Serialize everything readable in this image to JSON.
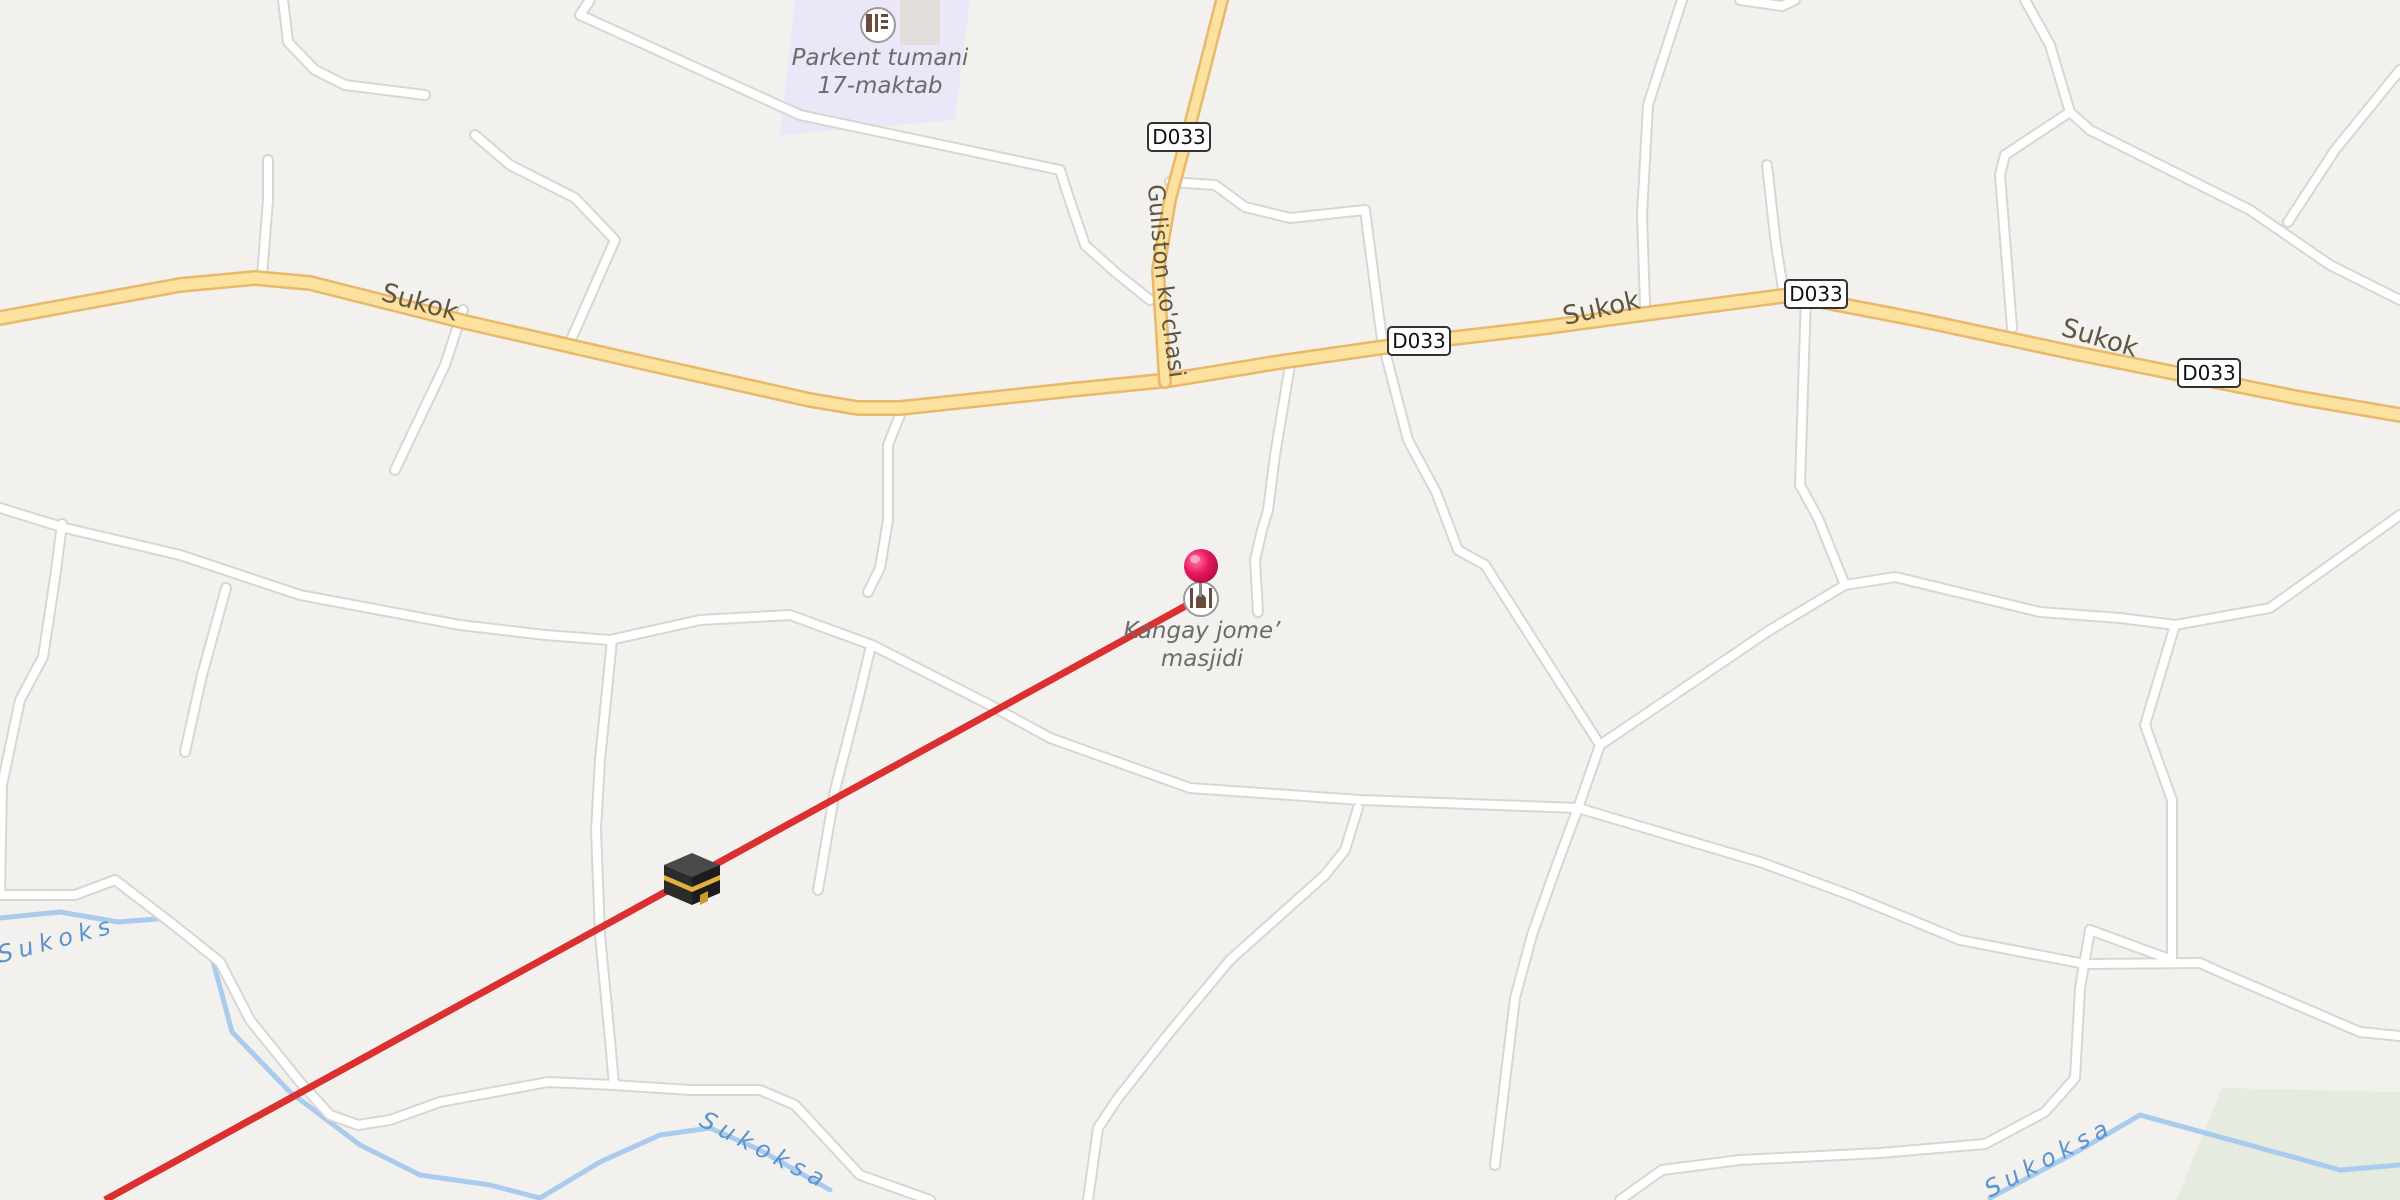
{
  "map": {
    "colors": {
      "background": "#f3f1ee",
      "minor_road": "#ffffff",
      "minor_road_casing": "#d9d6d1",
      "major_road": "#fce29e",
      "major_road_casing": "#e8b86b",
      "river": "#a9cbee",
      "river_label": "#5b93cf",
      "school_area": "#ebe6f8",
      "greenery": "#e6ebe0",
      "qibla_line": "#dc2f2f",
      "pin": "#e8175d",
      "road_label": "#5f5640",
      "poi_label": "#6b6b6b",
      "shield_border": "#333333"
    },
    "roads": {
      "sukok_labels": [
        "Sukok",
        "Sukok",
        "Sukok"
      ],
      "d033_shields": [
        "D033",
        "D033",
        "D033",
        "D033"
      ],
      "guliston_label": "Guliston ko'chasi"
    },
    "rivers": {
      "labels": [
        "Sukoksay",
        "Sukoksay",
        "Sukoksay"
      ]
    },
    "poi": {
      "school_line1": "Parkent tumani",
      "school_line2": "17-maktab",
      "school_icon": "school-icon",
      "mosque_line1": "Kangay jome’",
      "mosque_line2": "masjidi",
      "mosque_icon": "mosque-icon"
    },
    "markers": {
      "location_pin": "location-pin-icon",
      "kaaba": "kaaba-icon"
    }
  }
}
